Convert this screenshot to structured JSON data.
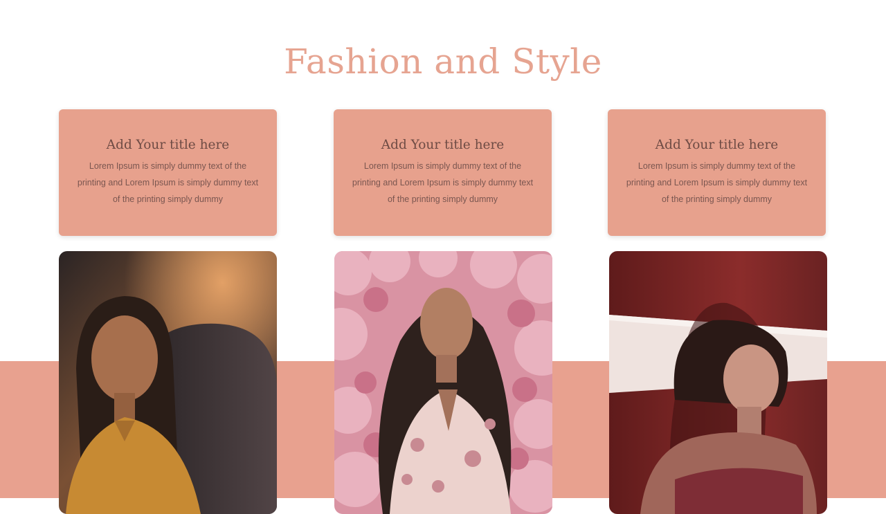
{
  "slide": {
    "title": "Fashion and Style"
  },
  "cards": [
    {
      "title": "Add Your title here",
      "body": "Lorem Ipsum  is simply  dummy text of the printing and Lorem Ipsum  is simply dummy text of the printing  simply dummy"
    },
    {
      "title": "Add Your title here",
      "body": "Lorem Ipsum  is simply  dummy text of the printing and Lorem Ipsum  is simply  dummy text of the printing  simply dummy"
    },
    {
      "title": "Add Your title here",
      "body": "Lorem Ipsum  is simply  dummy text of the printing and Lorem Ipsum  is simply  dummy text of the printing  simply dummy"
    }
  ],
  "colors": {
    "accent": "#e8a18f",
    "title": "#e6a491",
    "card_text": "#6e4b44"
  }
}
